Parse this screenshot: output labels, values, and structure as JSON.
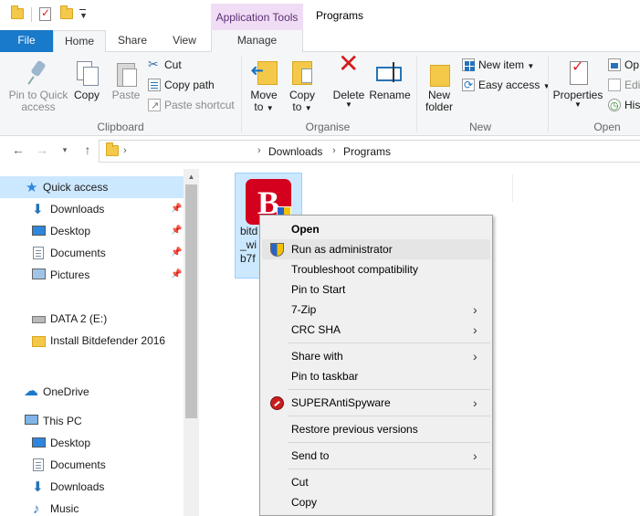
{
  "window": {
    "title": "Programs",
    "contextual_tab_group": "Application Tools"
  },
  "tabs": {
    "file": "File",
    "home": "Home",
    "share": "Share",
    "view": "View",
    "manage": "Manage"
  },
  "ribbon": {
    "clipboard": {
      "label": "Clipboard",
      "pin_line1": "Pin to Quick",
      "pin_line2": "access",
      "copy": "Copy",
      "paste": "Paste",
      "cut": "Cut",
      "copy_path": "Copy path",
      "paste_shortcut": "Paste shortcut"
    },
    "organise": {
      "label": "Organise",
      "move_to": "Move",
      "move_to_line2": "to",
      "copy_to": "Copy",
      "copy_to_line2": "to",
      "delete": "Delete",
      "rename": "Rename"
    },
    "new": {
      "label": "New",
      "new_folder_line1": "New",
      "new_folder_line2": "folder",
      "new_item": "New item",
      "easy_access": "Easy access"
    },
    "open": {
      "label": "Open",
      "properties": "Properties",
      "open": "Op",
      "edit": "Edi",
      "history": "Hist"
    }
  },
  "address": {
    "crumbs": [
      "Downloads",
      "Programs"
    ]
  },
  "nav": {
    "quick_access": "Quick access",
    "items": [
      {
        "label": "Downloads",
        "icon": "download-icon",
        "pinned": true
      },
      {
        "label": "Desktop",
        "icon": "desktop-icon",
        "pinned": true
      },
      {
        "label": "Documents",
        "icon": "documents-icon",
        "pinned": true
      },
      {
        "label": "Pictures",
        "icon": "pictures-icon",
        "pinned": true
      }
    ],
    "drive": "DATA 2 (E:)",
    "folder": "Install Bitdefender 2016",
    "onedrive": "OneDrive",
    "this_pc": "This PC",
    "pc_items": [
      "Desktop",
      "Documents",
      "Downloads",
      "Music"
    ]
  },
  "content": {
    "file": {
      "icon_letter": "B",
      "name_lines": [
        "bitd",
        "_wi",
        "b7f"
      ]
    }
  },
  "context_menu": {
    "items": [
      {
        "label": "Open",
        "bold": true
      },
      {
        "label": "Run as administrator",
        "icon": "uac-shield-icon"
      },
      {
        "label": "Troubleshoot compatibility"
      },
      {
        "label": "Pin to Start"
      },
      {
        "label": "7-Zip",
        "submenu": true
      },
      {
        "label": "CRC SHA",
        "submenu": true
      },
      {
        "label": "Share with",
        "submenu": true
      },
      {
        "label": "Pin to taskbar"
      },
      {
        "label": "SUPERAntiSpyware",
        "submenu": true,
        "icon": "superantispyware-icon"
      },
      {
        "label": "Restore previous versions"
      },
      {
        "label": "Send to",
        "submenu": true
      },
      {
        "label": "Cut"
      },
      {
        "label": "Copy"
      }
    ]
  },
  "colors": {
    "file_tab": "#1979ca",
    "selection": "#cce8ff",
    "contextual_tab": "#f0ddf5",
    "delete_icon": "#d31b1b",
    "bitdefender_red": "#d3001e"
  }
}
